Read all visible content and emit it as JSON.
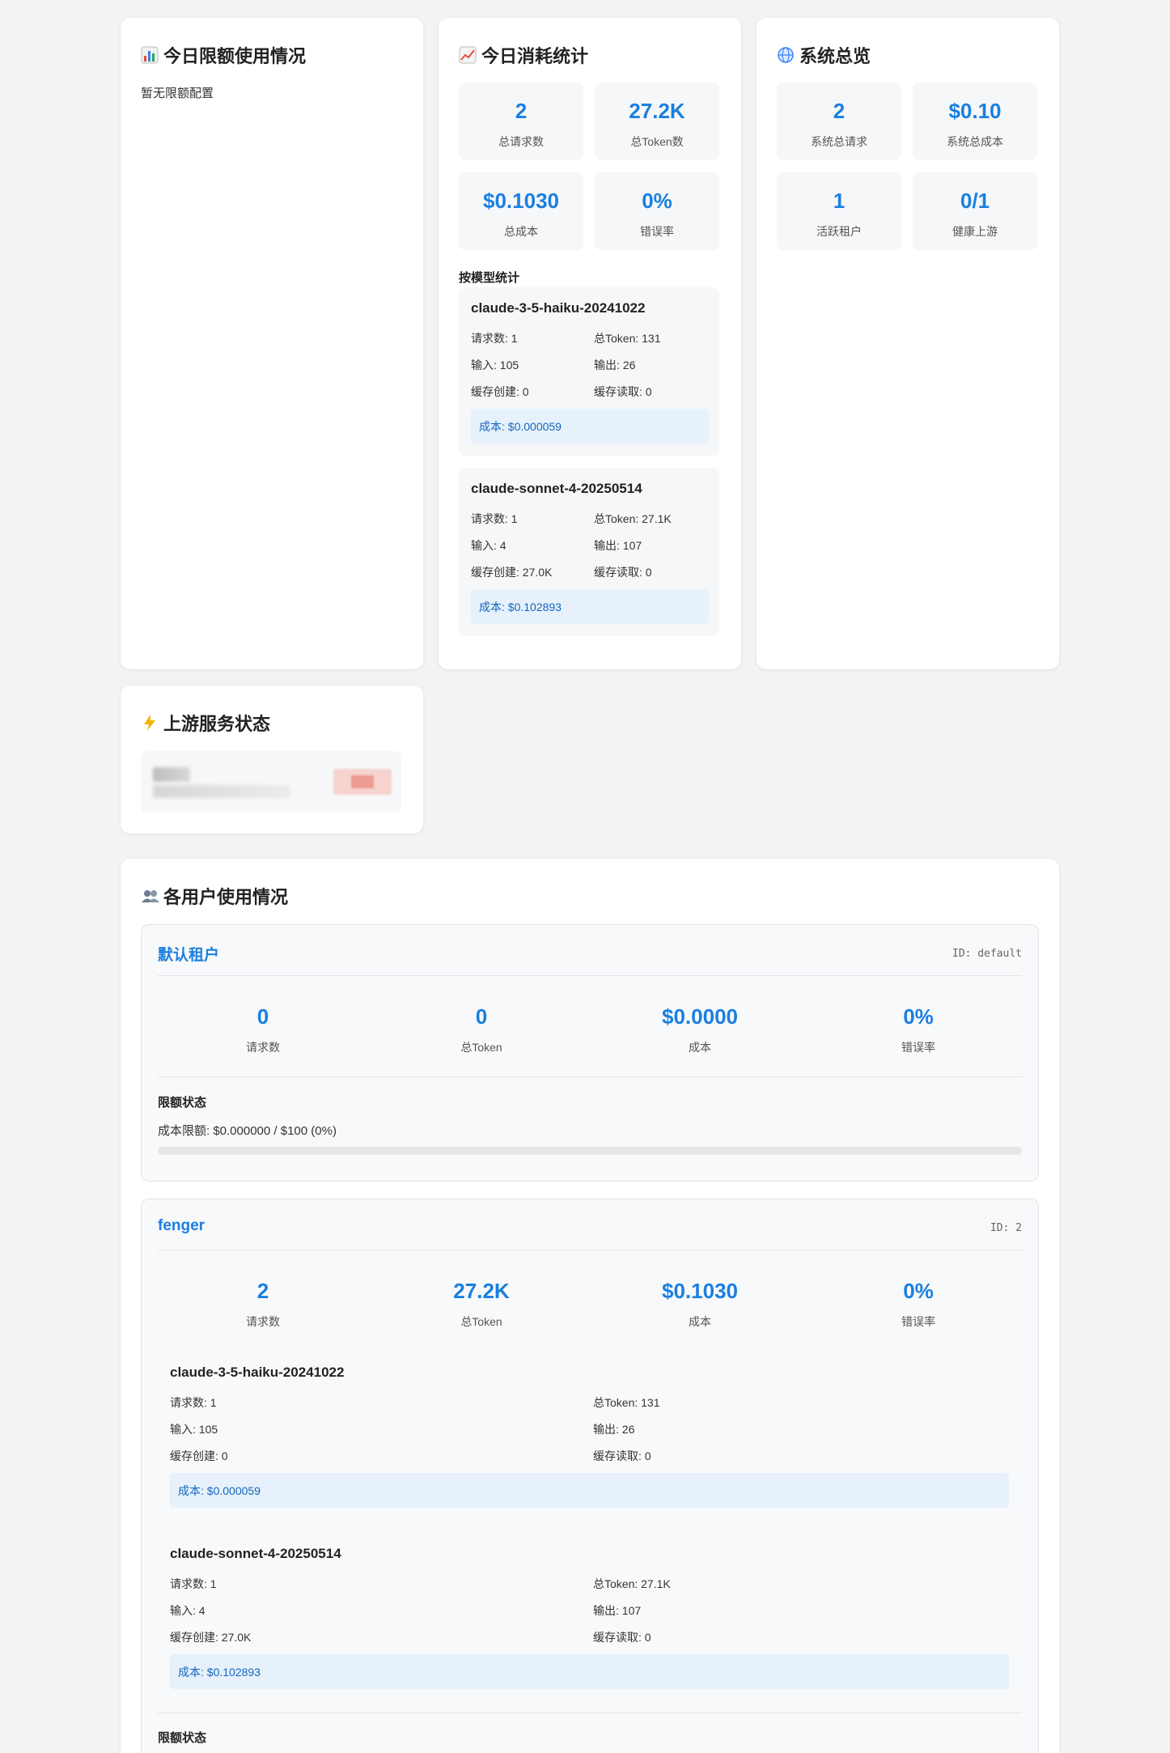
{
  "quota_card": {
    "title": "今日限额使用情况",
    "icon": "bar-chart-icon",
    "empty_text": "暂无限额配置"
  },
  "consumption_card": {
    "title": "今日消耗统计",
    "icon": "trend-chart-icon",
    "stats": [
      {
        "value": "2",
        "label": "总请求数"
      },
      {
        "value": "27.2K",
        "label": "总Token数"
      },
      {
        "value": "$0.1030",
        "label": "总成本"
      },
      {
        "value": "0%",
        "label": "错误率"
      }
    ],
    "by_model_heading": "按模型统计",
    "models": [
      {
        "name": "claude-3-5-haiku-20241022",
        "requests": "请求数: 1",
        "total_tokens": "总Token: 131",
        "input": "输入: 105",
        "output": "输出: 26",
        "cache_create": "缓存创建: 0",
        "cache_read": "缓存读取: 0",
        "cost": "成本: $0.000059"
      },
      {
        "name": "claude-sonnet-4-20250514",
        "requests": "请求数: 1",
        "total_tokens": "总Token: 27.1K",
        "input": "输入: 4",
        "output": "输出: 107",
        "cache_create": "缓存创建: 27.0K",
        "cache_read": "缓存读取: 0",
        "cost": "成本: $0.102893"
      }
    ]
  },
  "system_card": {
    "title": "系统总览",
    "icon": "globe-icon",
    "stats": [
      {
        "value": "2",
        "label": "系统总请求"
      },
      {
        "value": "$0.10",
        "label": "系统总成本"
      },
      {
        "value": "1",
        "label": "活跃租户"
      },
      {
        "value": "0/1",
        "label": "健康上游"
      }
    ]
  },
  "upstream_card": {
    "title": "上游服务状态",
    "icon": "lightning-icon"
  },
  "users_card": {
    "title": "各用户使用情况",
    "icon": "users-icon",
    "users": [
      {
        "name": "默认租户",
        "id": "ID: default",
        "stats": [
          {
            "value": "0",
            "label": "请求数"
          },
          {
            "value": "0",
            "label": "总Token"
          },
          {
            "value": "$0.0000",
            "label": "成本"
          },
          {
            "value": "0%",
            "label": "错误率"
          }
        ],
        "quota_heading": "限额状态",
        "quota_text": "成本限额: $0.000000 / $100 (0%)",
        "quota_percent": 0
      },
      {
        "name": "fenger",
        "id": "ID: 2",
        "stats": [
          {
            "value": "2",
            "label": "请求数"
          },
          {
            "value": "27.2K",
            "label": "总Token"
          },
          {
            "value": "$0.1030",
            "label": "成本"
          },
          {
            "value": "0%",
            "label": "错误率"
          }
        ],
        "models": [
          {
            "name": "claude-3-5-haiku-20241022",
            "requests": "请求数: 1",
            "total_tokens": "总Token: 131",
            "input": "输入: 105",
            "output": "输出: 26",
            "cache_create": "缓存创建: 0",
            "cache_read": "缓存读取: 0",
            "cost": "成本: $0.000059"
          },
          {
            "name": "claude-sonnet-4-20250514",
            "requests": "请求数: 1",
            "total_tokens": "总Token: 27.1K",
            "input": "输入: 4",
            "output": "输出: 107",
            "cache_create": "缓存创建: 27.0K",
            "cache_read": "缓存读取: 0",
            "cost": "成本: $0.102893"
          }
        ],
        "quota_heading": "限额状态"
      }
    ]
  },
  "colors": {
    "accent": "#1a7fe0",
    "cost_bg": "#e6f1fb",
    "cost_text": "#1565c0"
  }
}
